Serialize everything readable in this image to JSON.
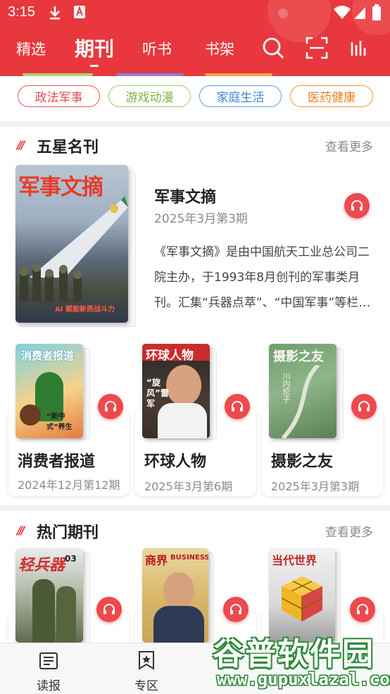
{
  "status_bar": {
    "time": "3:15"
  },
  "top_tabs": [
    {
      "label": "精选",
      "active": false
    },
    {
      "label": "期刊",
      "active": true
    },
    {
      "label": "听书",
      "active": false
    },
    {
      "label": "书架",
      "active": false
    }
  ],
  "category_chips": [
    {
      "label": "政法军事",
      "color": "#e04a4f"
    },
    {
      "label": "游戏动漫",
      "color": "#8cc152"
    },
    {
      "label": "家庭生活",
      "color": "#4a90d9"
    },
    {
      "label": "医药健康",
      "color": "#f08a24"
    }
  ],
  "five_star": {
    "title": "五星名刊",
    "more": "查看更多",
    "featured": {
      "title": "军事文摘",
      "issue": "2025年3月第3期",
      "description": "《军事文摘》是由中国航天工业总公司二院主办，于1993年8月创刊的军事类月刊。汇集“兵器点萃”、“中国军事”等栏目。",
      "cover_title": "军事文摘",
      "cover_caption": "AI 赋能新质战斗力"
    },
    "items": [
      {
        "title": "消费者报道",
        "issue": "2024年12月第12期",
        "cover_title": "消费者报道",
        "cover_caption": "“新中式”养生"
      },
      {
        "title": "环球人物",
        "issue": "2025年3月第6期",
        "cover_title": "环球人物",
        "cover_caption": "“旋风”雷军"
      },
      {
        "title": "摄影之友",
        "issue": "2025年3月第3期",
        "cover_title": "摄影之友",
        "cover_caption": "川内伦子"
      }
    ]
  },
  "hot": {
    "title": "热门期刊",
    "more": "查看更多",
    "items": [
      {
        "cover_title": "轻兵器",
        "cover_badge": "03"
      },
      {
        "cover_title": "商界",
        "cover_badge": "BUSINESS"
      },
      {
        "cover_title": "当代世界"
      }
    ]
  },
  "bottom_nav": [
    {
      "label": "读报",
      "icon": "newspaper-icon"
    },
    {
      "label": "专区",
      "icon": "star-bookmark-icon"
    }
  ],
  "watermark": {
    "name": "谷普软件园",
    "url": "www.gupuxlazal.com"
  }
}
